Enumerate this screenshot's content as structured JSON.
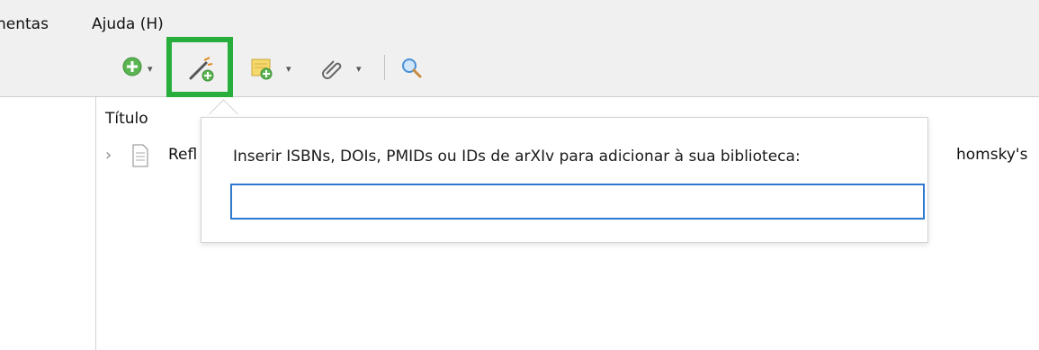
{
  "menu": {
    "tools_label": "nentas",
    "help_label": "Ajuda (H)"
  },
  "toolbar": {
    "icons": [
      "new-item-icon",
      "add-by-identifier-icon",
      "new-note-icon",
      "add-attachment-icon",
      "search-icon"
    ],
    "highlight_color": "#27ae3c"
  },
  "list": {
    "column_header": "Título",
    "rows": [
      {
        "title_visible": "Refl",
        "title_tail": "homsky's"
      }
    ]
  },
  "popup": {
    "label": "Inserir ISBNs, DOIs, PMIDs ou IDs de arXIv para adicionar à sua biblioteca:",
    "input_value": "",
    "input_border_color": "#2f78d0"
  }
}
